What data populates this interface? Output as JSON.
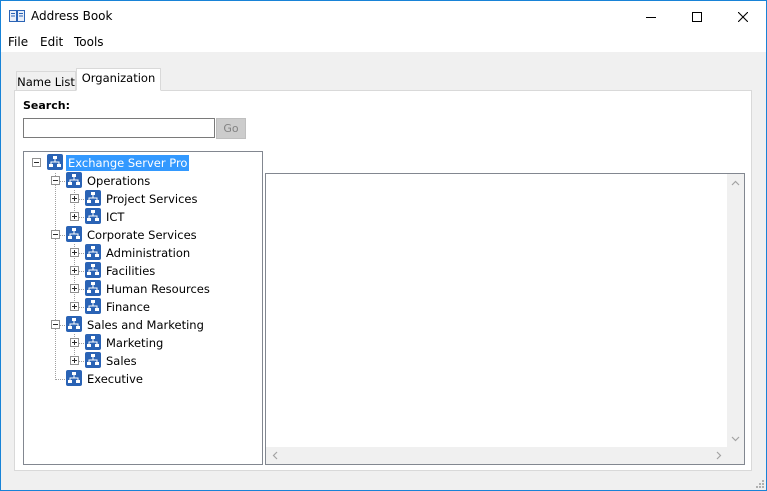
{
  "window": {
    "title": "Address Book",
    "icons": {
      "app": "address-book-icon",
      "minimize": "minimize-icon",
      "maximize": "maximize-icon",
      "close": "close-icon"
    }
  },
  "menu": [
    "File",
    "Edit",
    "Tools"
  ],
  "tabs": [
    {
      "label": "Name List",
      "active": false
    },
    {
      "label": "Organization",
      "active": true
    }
  ],
  "search": {
    "label": "Search:",
    "value": "",
    "button": "Go"
  },
  "tree": {
    "root": "Exchange Server Pro",
    "groups": [
      {
        "label": "Operations",
        "children": [
          "Project Services",
          "ICT"
        ]
      },
      {
        "label": "Corporate Services",
        "children": [
          "Administration",
          "Facilities",
          "Human Resources",
          "Finance"
        ]
      },
      {
        "label": "Sales and Marketing",
        "children": [
          "Marketing",
          "Sales"
        ]
      },
      {
        "label": "Executive",
        "children": []
      }
    ],
    "node_icon": "org-chart-icon"
  },
  "colors": {
    "selection": "#3399ff",
    "window_border": "#1883d7",
    "icon_blue": "#2a63b5"
  }
}
